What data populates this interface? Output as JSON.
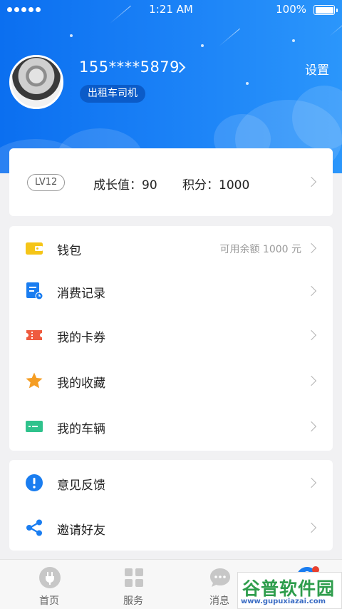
{
  "status_bar": {
    "time": "1:21 AM",
    "battery": "100%"
  },
  "profile": {
    "phone": "155****5879",
    "role": "出租车司机",
    "settings_label": "设置"
  },
  "level": {
    "badge": "LV12",
    "growth": "成长值：90",
    "points": "积分：1000"
  },
  "menu_group_1": [
    {
      "label": "钱包",
      "right_text": "可用余额 1000 元",
      "icon": "wallet-icon",
      "color": "#f5c518"
    },
    {
      "label": "消费记录",
      "right_text": "",
      "icon": "receipt-clock-icon",
      "color": "#1a7df0"
    },
    {
      "label": "我的卡券",
      "right_text": "",
      "icon": "ticket-icon",
      "color": "#ef5b3f"
    },
    {
      "label": "我的收藏",
      "right_text": "",
      "icon": "star-icon",
      "color": "#f59d23"
    },
    {
      "label": "我的车辆",
      "right_text": "",
      "icon": "vehicle-card-icon",
      "color": "#2fc28c"
    }
  ],
  "menu_group_2": [
    {
      "label": "意见反馈",
      "icon": "exclamation-icon",
      "color": "#1a7df0"
    },
    {
      "label": "邀请好友",
      "icon": "share-icon",
      "color": "#1a7df0"
    }
  ],
  "tabs": [
    {
      "label": "首页",
      "icon": "plug-icon"
    },
    {
      "label": "服务",
      "icon": "grid-icon"
    },
    {
      "label": "消息",
      "icon": "chat-bubble-icon"
    },
    {
      "label": "",
      "icon": "profile-icon"
    }
  ],
  "watermark": {
    "title": "谷普软件园",
    "url": "www.gupuxiazai.com"
  }
}
